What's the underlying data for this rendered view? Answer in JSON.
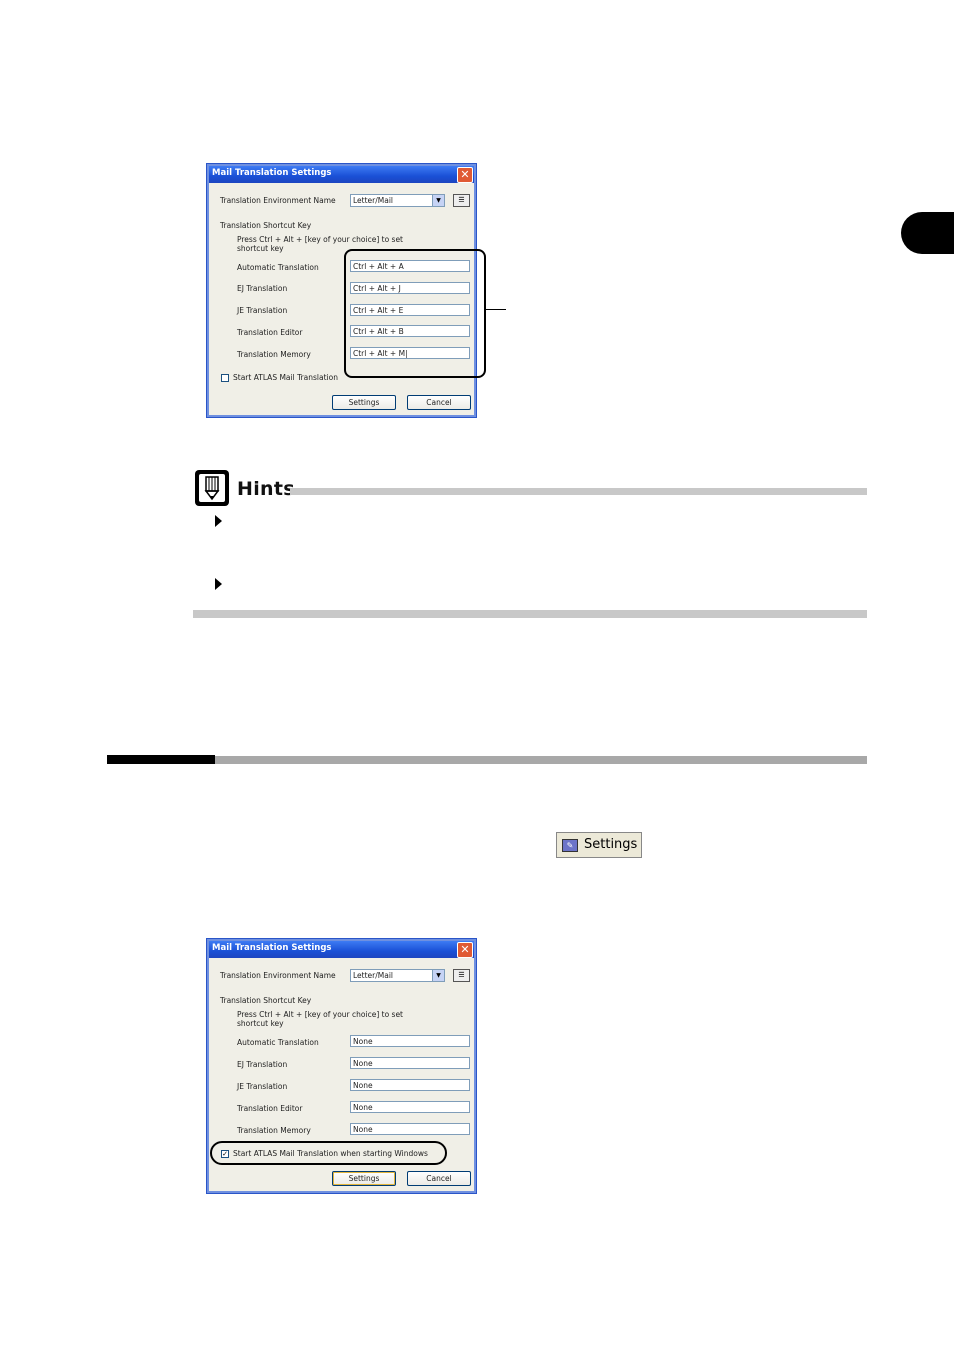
{
  "dialog_top": {
    "title": "Mail Translation Settings",
    "close_glyph": "✕",
    "env_label": "Translation Environment Name",
    "env_value": "Letter/Mail",
    "shortcut_header": "Translation Shortcut Key",
    "shortcut_help_line1": "Press Ctrl + Alt + [key of your choice] to set",
    "shortcut_help_line2": "shortcut key",
    "rows": [
      {
        "label": "Automatic Translation",
        "value": "Ctrl + Alt + A"
      },
      {
        "label": "EJ Translation",
        "value": "Ctrl + Alt + J"
      },
      {
        "label": "JE Translation",
        "value": "Ctrl + Alt + E"
      },
      {
        "label": "Translation Editor",
        "value": "Ctrl + Alt + B"
      },
      {
        "label": "Translation Memory",
        "value": "Ctrl + Alt + M|"
      }
    ],
    "startup_label": "Start ATLAS Mail Translation",
    "startup_checked": false,
    "settings_button": "Settings",
    "cancel_button": "Cancel"
  },
  "hints": {
    "title": "Hints"
  },
  "toolbar_button": {
    "label": "Settings",
    "icon": "settings-icon"
  },
  "dialog_bottom": {
    "title": "Mail Translation Settings",
    "close_glyph": "✕",
    "env_label": "Translation Environment Name",
    "env_value": "Letter/Mail",
    "shortcut_header": "Translation Shortcut Key",
    "shortcut_help_line1": "Press Ctrl + Alt + [key of your choice] to set",
    "shortcut_help_line2": "shortcut key",
    "rows": [
      {
        "label": "Automatic Translation",
        "value": "None"
      },
      {
        "label": "EJ Translation",
        "value": "None"
      },
      {
        "label": "JE Translation",
        "value": "None"
      },
      {
        "label": "Translation Editor",
        "value": "None"
      },
      {
        "label": "Translation Memory",
        "value": "None"
      }
    ],
    "startup_label": "Start ATLAS Mail Translation when starting Windows",
    "startup_checked": true,
    "check_glyph": "✓",
    "settings_button": "Settings",
    "cancel_button": "Cancel"
  },
  "colors": {
    "titlebar": "#1a50d6",
    "close_button": "#e05a34",
    "dialog_bg": "#f0efe7",
    "section_bar": "#a8a8a8"
  }
}
